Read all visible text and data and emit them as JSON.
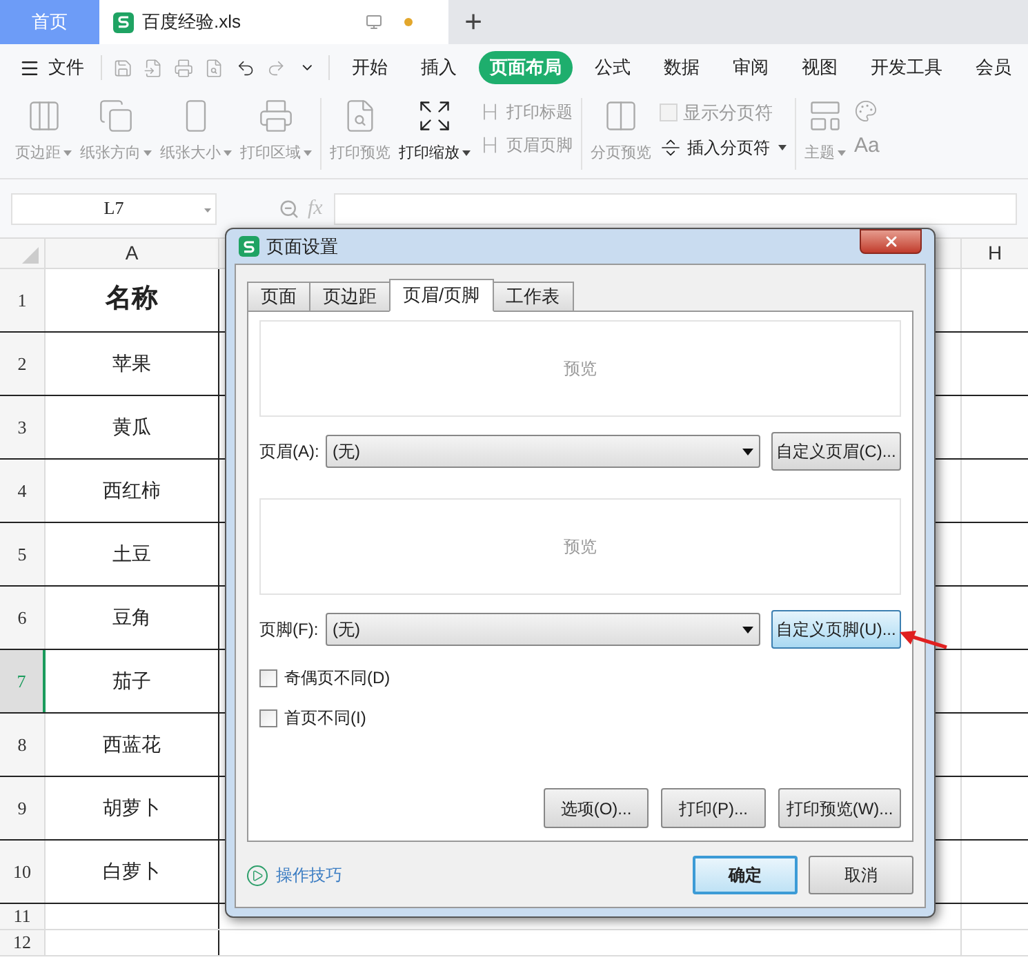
{
  "title_tabs": {
    "home": {
      "label": "首页",
      "selected": false
    },
    "file": {
      "label": "百度经验.xls",
      "selected": true,
      "unsaved": true
    },
    "new_tab": "+"
  },
  "menu": {
    "file_label": "文件",
    "ribbon_tabs": [
      {
        "label": "开始",
        "selected": false
      },
      {
        "label": "插入",
        "selected": false
      },
      {
        "label": "页面布局",
        "selected": true
      },
      {
        "label": "公式",
        "selected": false
      },
      {
        "label": "数据",
        "selected": false
      },
      {
        "label": "审阅",
        "selected": false
      },
      {
        "label": "视图",
        "selected": false
      },
      {
        "label": "开发工具",
        "selected": false
      },
      {
        "label": "会员",
        "selected": false
      }
    ]
  },
  "ribbon": [
    {
      "kind": "big",
      "label": "页边距",
      "dropdown": true,
      "disabled": true
    },
    {
      "kind": "big",
      "label": "纸张方向",
      "dropdown": true,
      "disabled": true
    },
    {
      "kind": "big",
      "label": "纸张大小",
      "dropdown": true,
      "disabled": true
    },
    {
      "kind": "big",
      "label": "打印区域",
      "dropdown": true,
      "disabled": true
    },
    {
      "kind": "separator"
    },
    {
      "kind": "big",
      "label": "打印预览",
      "dropdown": false,
      "disabled": true
    },
    {
      "kind": "big",
      "label": "打印缩放",
      "dropdown": true,
      "disabled": false
    },
    {
      "kind": "stack",
      "items": [
        {
          "kind": "small",
          "label": "打印标题",
          "dropdown": false,
          "disabled": true
        },
        {
          "kind": "small",
          "label": "页眉页脚",
          "dropdown": false,
          "disabled": true
        }
      ]
    },
    {
      "kind": "separator"
    },
    {
      "kind": "big",
      "label": "分页预览",
      "dropdown": false,
      "disabled": true
    },
    {
      "kind": "stack",
      "items": [
        {
          "kind": "check",
          "label": "显示分页符",
          "checked": false,
          "disabled": true
        },
        {
          "kind": "small",
          "label": "插入分页符",
          "dropdown": true,
          "disabled": false
        }
      ]
    },
    {
      "kind": "separator"
    },
    {
      "kind": "big",
      "label": "主题",
      "dropdown": true,
      "disabled": true
    },
    {
      "kind": "stack",
      "items": [
        {
          "kind": "icon",
          "disabled": true
        },
        {
          "kind": "text",
          "label": "Aa",
          "disabled": true
        }
      ]
    }
  ],
  "formula_bar": {
    "name_box": "L7",
    "fx": "fx"
  },
  "sheet": {
    "columns": [
      "A",
      "H"
    ],
    "rows": [
      {
        "number": "1",
        "cell": "名称",
        "kind": "header",
        "selected": false
      },
      {
        "number": "2",
        "cell": "苹果",
        "kind": "item",
        "selected": false
      },
      {
        "number": "3",
        "cell": "黄瓜",
        "kind": "item",
        "selected": false
      },
      {
        "number": "4",
        "cell": "西红柿",
        "kind": "item",
        "selected": false
      },
      {
        "number": "5",
        "cell": "土豆",
        "kind": "item",
        "selected": false
      },
      {
        "number": "6",
        "cell": "豆角",
        "kind": "item",
        "selected": false
      },
      {
        "number": "7",
        "cell": "茄子",
        "kind": "item",
        "selected": true
      },
      {
        "number": "8",
        "cell": "西蓝花",
        "kind": "item",
        "selected": false
      },
      {
        "number": "9",
        "cell": "胡萝卜",
        "kind": "item",
        "selected": false
      },
      {
        "number": "10",
        "cell": "白萝卜",
        "kind": "item",
        "selected": false
      },
      {
        "number": "11",
        "kind": "empty",
        "selected": false
      },
      {
        "number": "12",
        "kind": "empty",
        "selected": false
      }
    ]
  },
  "dialog": {
    "title": "页面设置",
    "tabs": [
      {
        "label": "页面",
        "selected": false
      },
      {
        "label": "页边距",
        "selected": false
      },
      {
        "label": "页眉/页脚",
        "selected": true
      },
      {
        "label": "工作表",
        "selected": false
      }
    ],
    "header": {
      "preview": "预览",
      "label": "页眉(A):",
      "value": "(无)",
      "button": "自定义页眉(C)...",
      "highlighted": false
    },
    "footer": {
      "preview": "预览",
      "label": "页脚(F):",
      "value": "(无)",
      "button": "自定义页脚(U)...",
      "highlighted": true
    },
    "checkboxes": [
      {
        "label": "奇偶页不同(D)",
        "checked": false
      },
      {
        "label": "首页不同(I)",
        "checked": false
      }
    ],
    "action_buttons": [
      "选项(O)...",
      "打印(P)...",
      "打印预览(W)..."
    ],
    "tips_link": "操作技巧",
    "ok": "确定",
    "cancel": "取消"
  }
}
